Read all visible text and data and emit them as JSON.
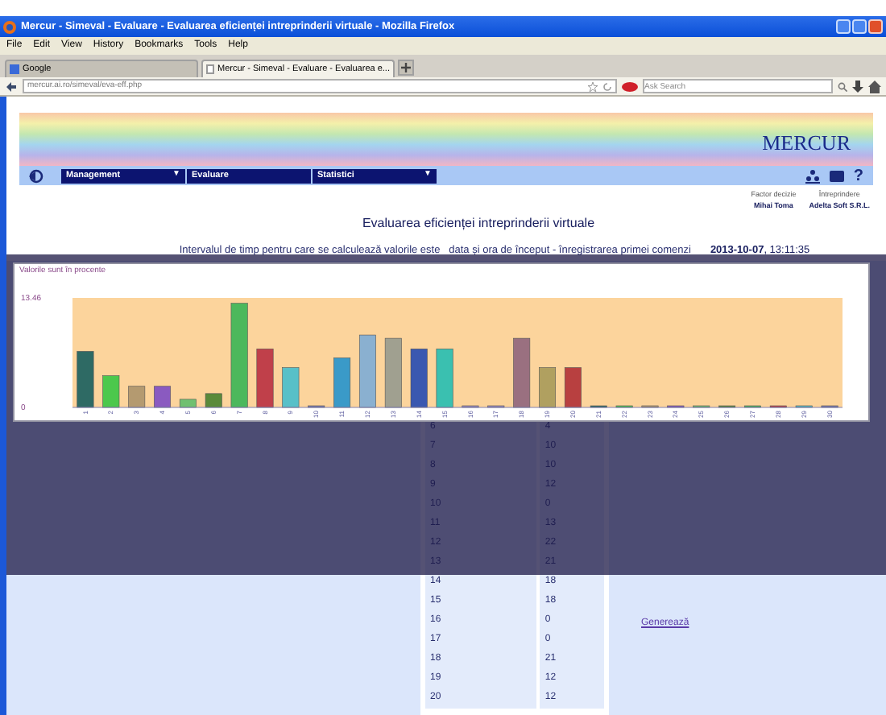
{
  "window": {
    "title": "Mercur - Simeval - Evaluare - Evaluarea eficienței intreprinderii virtuale - Mozilla Firefox"
  },
  "menu_bar": [
    "File",
    "Edit",
    "View",
    "History",
    "Bookmarks",
    "Tools",
    "Help"
  ],
  "tabs": [
    {
      "label": "Google",
      "selected": false
    },
    {
      "label": "Mercur - Simeval - Evaluare - Evaluarea e...",
      "selected": true
    }
  ],
  "address_bar": {
    "value": "mercur.ai.ro/simeval/eva-eff.php"
  },
  "search": {
    "placeholder": "Ask Search"
  },
  "site": {
    "logo": "MERCUR",
    "nav": [
      {
        "label": "Management",
        "arrow": "▼"
      },
      {
        "label": "Evaluare"
      },
      {
        "label": "Statistici",
        "arrow": "▼"
      }
    ],
    "help": "?"
  },
  "user_info": [
    {
      "label": "Factor decizie",
      "value": "Mihai Toma"
    },
    {
      "label": "Întreprindere",
      "value": "Adelta Soft S.R.L."
    }
  ],
  "heading": "Evaluarea eficienței intreprinderii virtuale",
  "interval": {
    "text": "Intervalul de timp pentru care se calculează valorile este   data și ora de început - înregistrarea primei comenzi",
    "date": "2013-10-07",
    "time": ", 13:11:35"
  },
  "chart": {
    "chart_data": {
      "type": "bar",
      "title": "Valorile sunt în procente",
      "categories": [
        "1",
        "2",
        "3",
        "4",
        "5",
        "6",
        "7",
        "8",
        "9",
        "10",
        "11",
        "12",
        "13",
        "14",
        "15",
        "16",
        "17",
        "18",
        "19",
        "20",
        "21",
        "22",
        "23",
        "24",
        "25",
        "26",
        "27",
        "28",
        "29",
        "30"
      ],
      "series": [
        {
          "values": [
            6.9,
            3.9,
            2.6,
            2.6,
            1.0,
            1.7,
            12.8,
            7.2,
            4.9,
            0.2,
            6.1,
            8.9,
            8.5,
            7.2,
            7.2,
            0.2,
            0.2,
            8.5,
            4.9,
            4.9,
            0.2,
            0.2,
            0.2,
            0.2,
            0.2,
            0.2,
            0.2,
            0.2,
            0.2,
            0.2
          ]
        }
      ],
      "ylim": [
        0,
        13.46
      ],
      "yticks": [
        0,
        {
          "value": 13.46,
          "label": "13.46"
        }
      ]
    }
  },
  "table": {
    "rows": [
      [
        "6",
        "4"
      ],
      [
        "7",
        "10"
      ],
      [
        "8",
        "10"
      ],
      [
        "9",
        "12"
      ],
      [
        "10",
        "0"
      ],
      [
        "11",
        "13"
      ],
      [
        "12",
        "22"
      ],
      [
        "13",
        "21"
      ],
      [
        "14",
        "18"
      ],
      [
        "15",
        "18"
      ],
      [
        "16",
        "0"
      ],
      [
        "17",
        "0"
      ],
      [
        "18",
        "21"
      ],
      [
        "19",
        "12"
      ],
      [
        "20",
        "12"
      ]
    ]
  },
  "generate_link": "Generează"
}
